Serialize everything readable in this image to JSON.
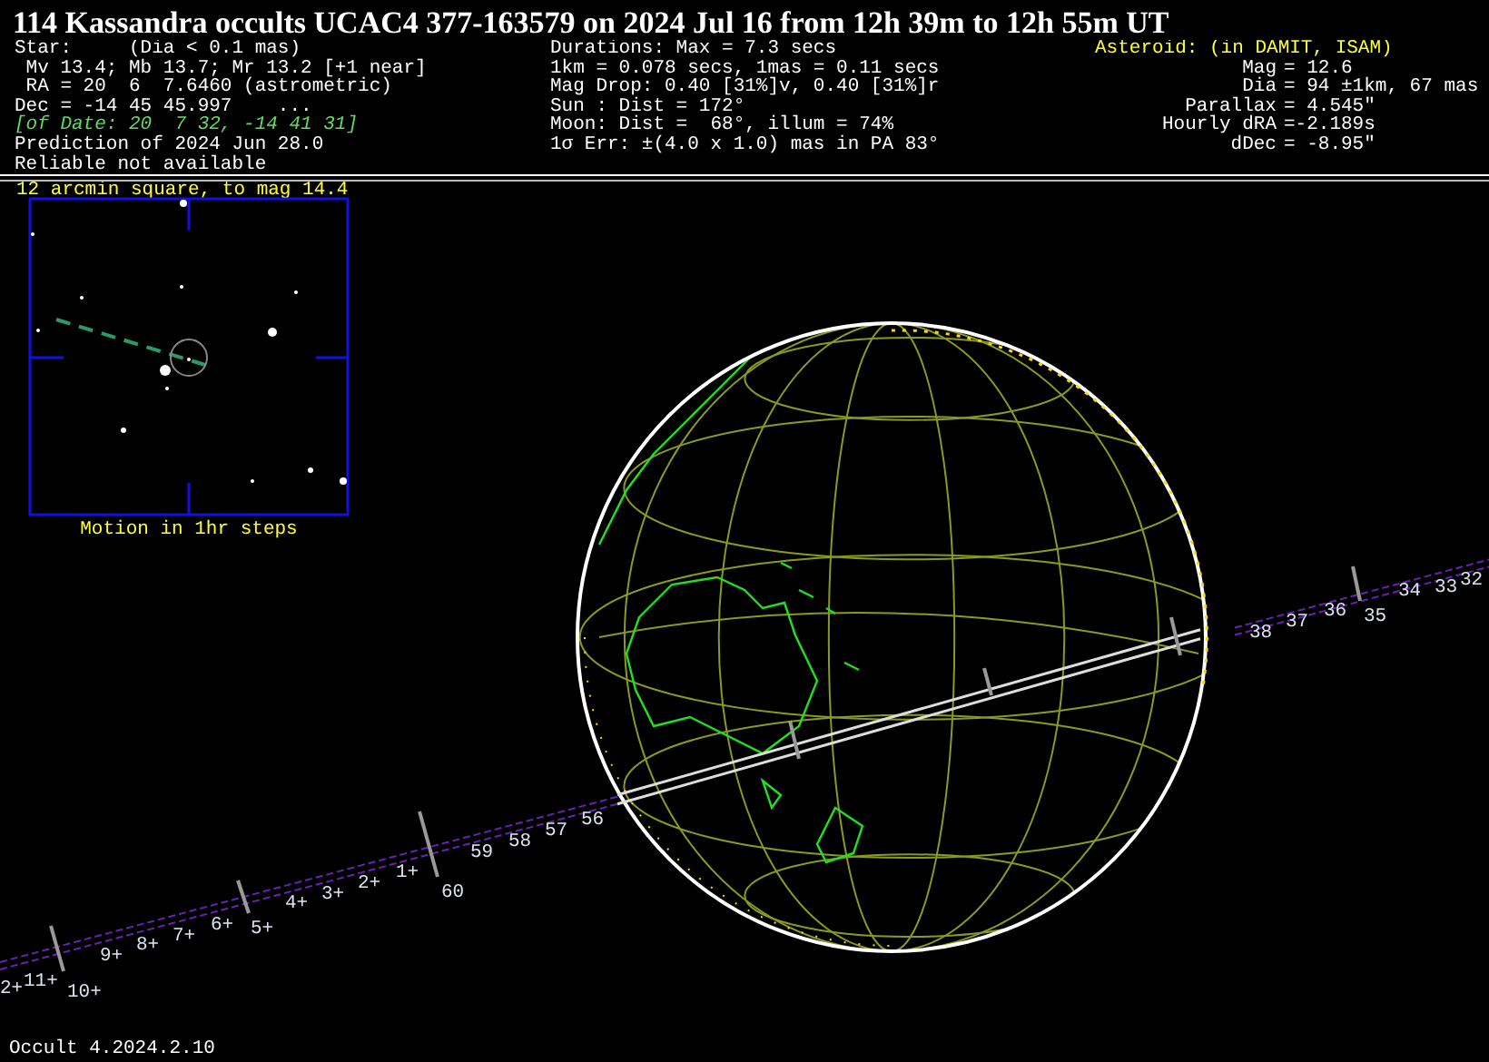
{
  "title": "114 Kassandra occults UCAC4 377-163579 on 2024 Jul 16 from 12h 39m to 12h 55m UT",
  "star_lines": [
    {
      "text": "Star:     (Dia < 0.1 mas)",
      "kind": "plain"
    },
    {
      "text": " Mv 13.4; Mb 13.7; Mr 13.2 [+1 near]",
      "kind": "plain"
    },
    {
      "text": " RA = 20  6  7.6460 (astrometric)",
      "kind": "plain"
    },
    {
      "text": "Dec = -14 45 45.997    ...",
      "kind": "plain"
    },
    {
      "text": "[of Date: 20  7 32, -14 41 31]",
      "kind": "note"
    },
    {
      "text": "Prediction of 2024 Jun 28.0",
      "kind": "plain"
    },
    {
      "text": "Reliable not available",
      "kind": "plain"
    }
  ],
  "circumstances": [
    "Durations: Max = 7.3 secs",
    "1km = 0.078 secs, 1mas = 0.11 secs",
    "Mag Drop: 0.40 [31%]v, 0.40 [31%]r",
    "Sun : Dist = 172°",
    "Moon: Dist =  68°, illum = 74%",
    "1σ Err: ±(4.0 x 1.0) mas in PA 83°"
  ],
  "asteroid": {
    "heading": "Asteroid: (in DAMIT, ISAM)",
    "rows": [
      {
        "label": "Mag",
        "value": "= 12.6"
      },
      {
        "label": "Dia",
        "value": "= 94 ±1km, 67 mas"
      },
      {
        "label": "Parallax",
        "value": "= 4.545\""
      },
      {
        "label": "Hourly dRA",
        "value": "=-2.189s"
      },
      {
        "label": "dDec",
        "value": "= -8.95\""
      }
    ]
  },
  "finder": {
    "title": "12 arcmin square, to mag 14.4",
    "caption": "Motion in 1hr steps"
  },
  "time_labels": [
    "2+",
    "11+",
    "10+",
    "9+",
    "8+",
    "7+",
    "6+",
    "5+",
    "4+",
    "3+",
    "2+",
    "1+",
    "60",
    "59",
    "58",
    "57",
    "56",
    "38",
    "37",
    "36",
    "35",
    "34",
    "33",
    "32"
  ],
  "footer": "Occult 4.2024.2.10"
}
